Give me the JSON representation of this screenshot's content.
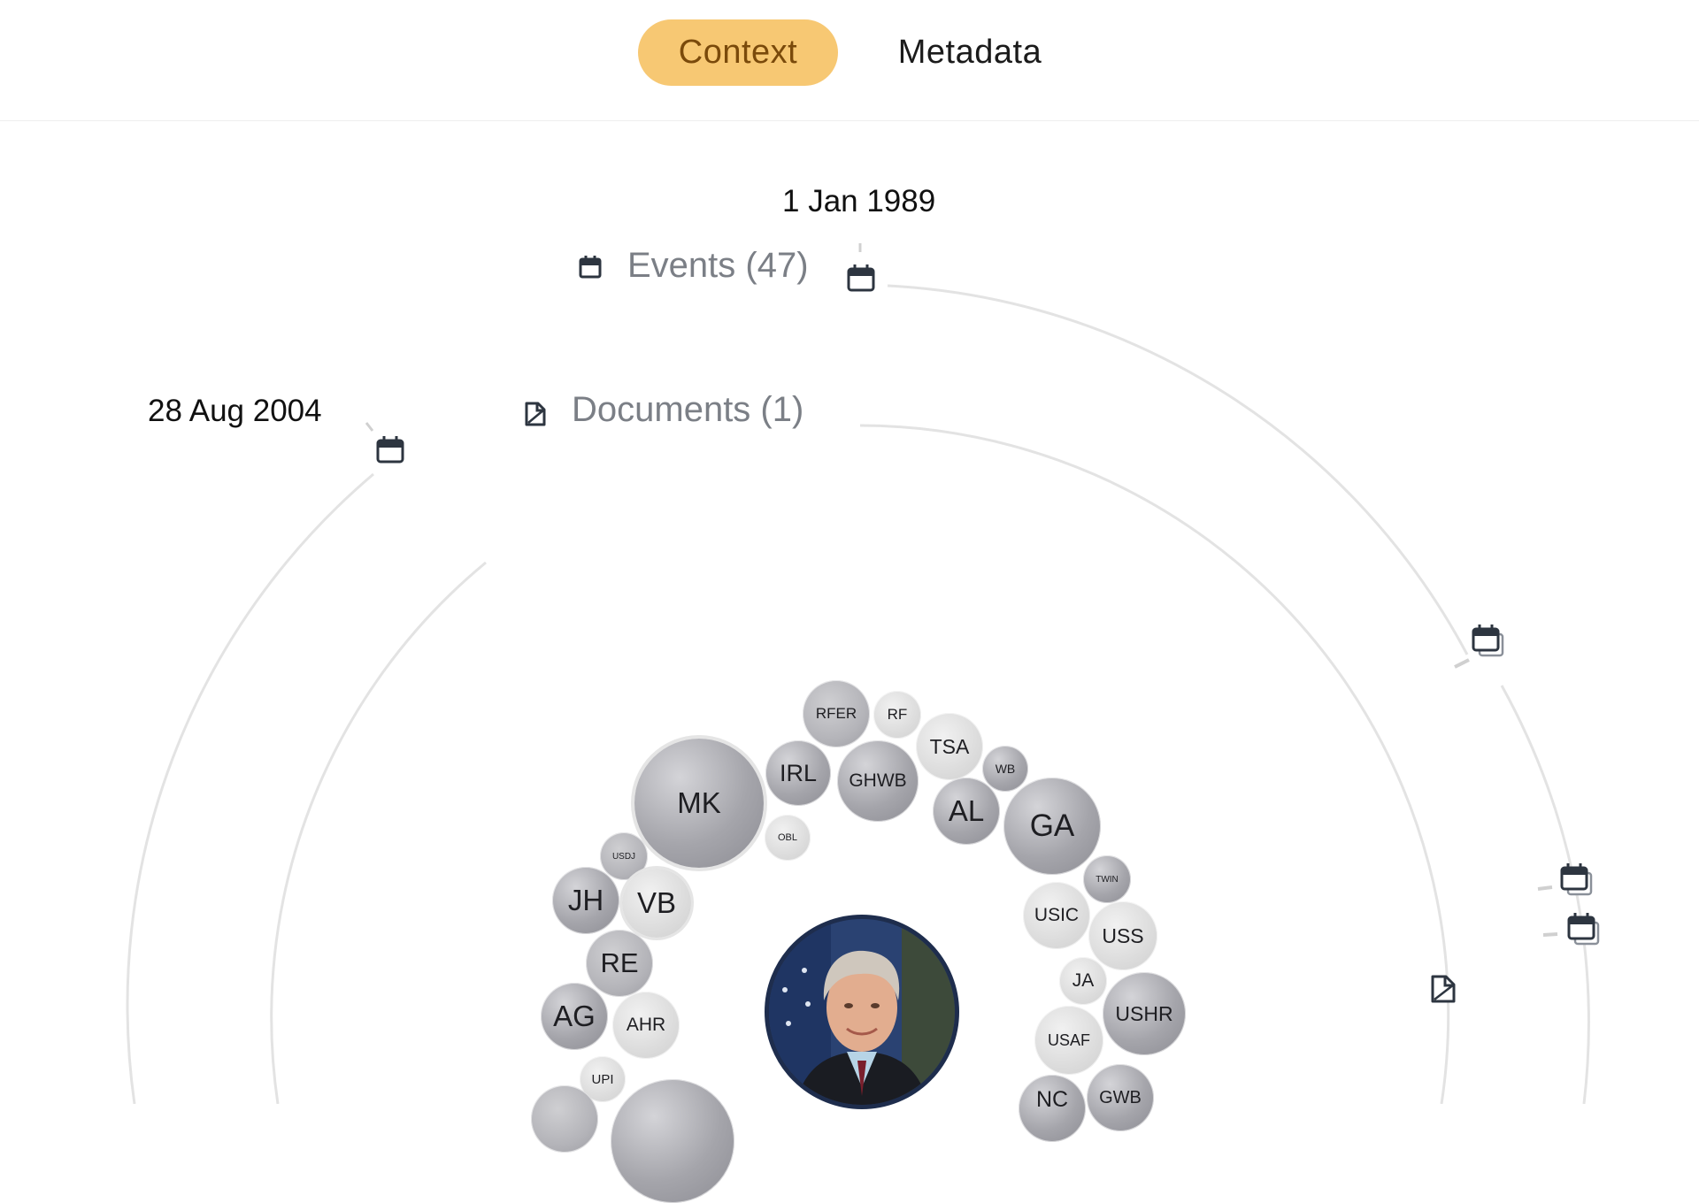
{
  "tabs": [
    {
      "label": "Context",
      "active": true
    },
    {
      "label": "Metadata",
      "active": false
    }
  ],
  "timeline": {
    "start_date": "1 Jan 1989",
    "end_date": "28 Aug 2004"
  },
  "categories": {
    "events": {
      "label": "Events (47)",
      "icon": "calendar-icon"
    },
    "documents": {
      "label": "Documents (1)",
      "icon": "document-icon"
    }
  },
  "entities": [
    {
      "abbr": "RFER"
    },
    {
      "abbr": "RF"
    },
    {
      "abbr": "TSA"
    },
    {
      "abbr": "WB"
    },
    {
      "abbr": "IRL"
    },
    {
      "abbr": "GHWB"
    },
    {
      "abbr": "MK"
    },
    {
      "abbr": "AL"
    },
    {
      "abbr": "GA"
    },
    {
      "abbr": "OBL"
    },
    {
      "abbr": "USDJ"
    },
    {
      "abbr": "TWIN"
    },
    {
      "abbr": "JH"
    },
    {
      "abbr": "VB"
    },
    {
      "abbr": "USIC"
    },
    {
      "abbr": "USS"
    },
    {
      "abbr": "RE"
    },
    {
      "abbr": "JA"
    },
    {
      "abbr": "USHR"
    },
    {
      "abbr": "AG"
    },
    {
      "abbr": "AHR"
    },
    {
      "abbr": "USAF"
    },
    {
      "abbr": "UPI"
    },
    {
      "abbr": "GWB"
    },
    {
      "abbr": "NC"
    }
  ],
  "center_entity": {
    "icon": "portrait-photo"
  },
  "colors": {
    "accent": "#f7c873",
    "accent_text": "#7a4a0b",
    "ring": "#e3e3e3",
    "icon": "#2d3540",
    "portrait_border": "#1e2d4d"
  }
}
